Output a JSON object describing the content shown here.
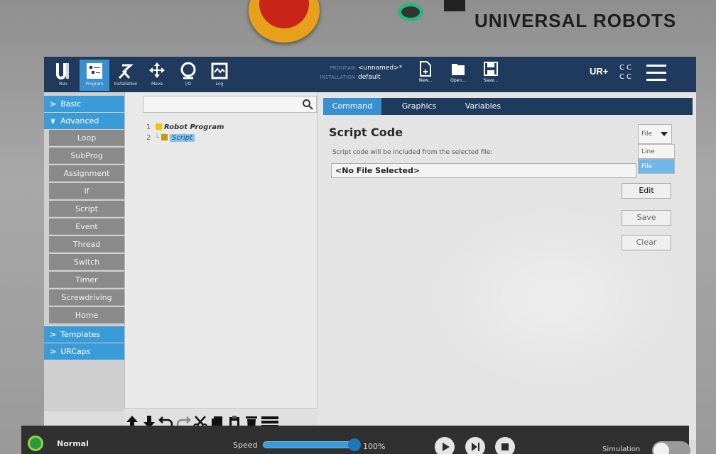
{
  "device": {
    "brand": "UNIVERSAL ROBOTS"
  },
  "topbar": {
    "tabs": [
      {
        "label": "Run",
        "icon": "ur-logo-icon"
      },
      {
        "label": "Program",
        "icon": "program-icon"
      },
      {
        "label": "Installation",
        "icon": "installation-icon"
      },
      {
        "label": "Move",
        "icon": "move-icon"
      },
      {
        "label": "I/O",
        "icon": "io-icon"
      },
      {
        "label": "Log",
        "icon": "log-icon"
      }
    ],
    "program_key": "PROGRAM",
    "program_value": "<unnamed>*",
    "installation_key": "INSTALLATION",
    "installation_value": "default",
    "file_buttons": [
      {
        "label": "New...",
        "icon": "new-file-icon"
      },
      {
        "label": "Open...",
        "icon": "folder-icon"
      },
      {
        "label": "Save...",
        "icon": "save-icon"
      }
    ],
    "cc": "C C\nC C"
  },
  "sidebar": {
    "basic": "Basic",
    "advanced": "Advanced",
    "advanced_items": [
      "Loop",
      "SubProg",
      "Assignment",
      "If",
      "Script",
      "Event",
      "Thread",
      "Switch",
      "Timer",
      "Screwdriving",
      "Home"
    ],
    "templates": "Templates",
    "urcaps": "URCaps"
  },
  "tree": {
    "rows": [
      {
        "num": "1",
        "label": "Robot Program"
      },
      {
        "num": "2",
        "label": "Script"
      }
    ]
  },
  "tabs": [
    "Command",
    "Graphics",
    "Variables"
  ],
  "command": {
    "title": "Script Code",
    "hint": "Script code will be included from the selected file:",
    "file_value": "<No File Selected>",
    "mode_selected": "File",
    "mode_options": [
      "Line",
      "File"
    ],
    "buttons": {
      "edit": "Edit",
      "save": "Save",
      "clear": "Clear"
    }
  },
  "footer": {
    "status": "Normal",
    "speed_label": "Speed",
    "speed_value": "100%",
    "speed_fraction": 1.0,
    "simulation": "Simulation"
  },
  "colors": {
    "accent": "#3a9bd9",
    "topbar": "#1f3a5c",
    "status_green": "#2c9b3a"
  }
}
